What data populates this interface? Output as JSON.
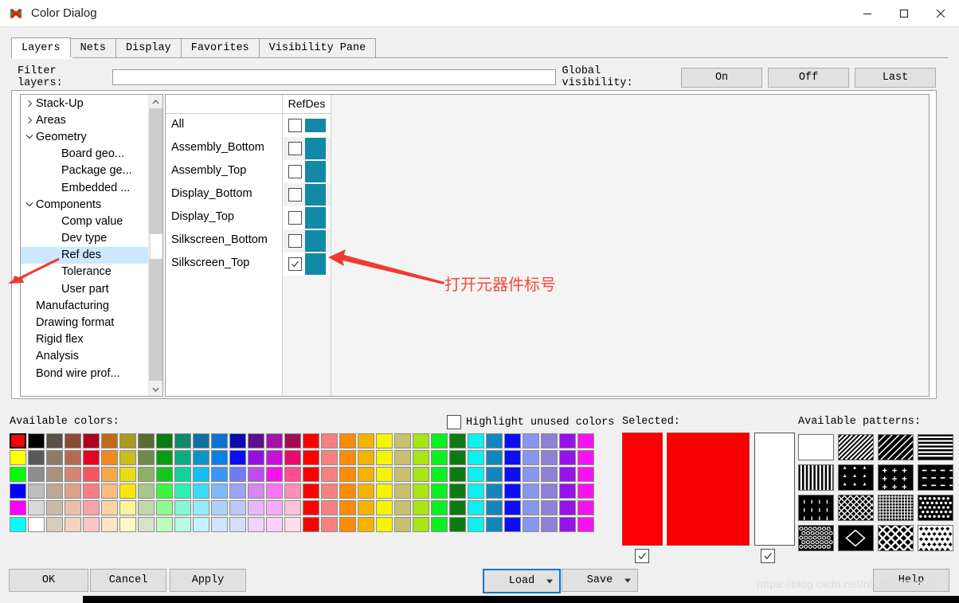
{
  "window": {
    "title": "Color Dialog",
    "app_icon": "butterfly-icon",
    "minimize": "—",
    "maximize": "□",
    "close": "✕"
  },
  "tabs": [
    {
      "label": "Layers",
      "active": true
    },
    {
      "label": "Nets",
      "active": false
    },
    {
      "label": "Display",
      "active": false
    },
    {
      "label": "Favorites",
      "active": false
    },
    {
      "label": "Visibility Pane",
      "active": false
    }
  ],
  "filter": {
    "label": "Filter layers:",
    "value": "",
    "placeholder": ""
  },
  "global_visibility": {
    "label": "Global visibility:",
    "buttons": [
      "On",
      "Off",
      "Last"
    ]
  },
  "tree": {
    "nodes": [
      {
        "label": "Stack-Up",
        "indent": 0,
        "chevron": "right",
        "selected": false
      },
      {
        "label": "Areas",
        "indent": 0,
        "chevron": "right",
        "selected": false
      },
      {
        "label": "Geometry",
        "indent": 0,
        "chevron": "down",
        "selected": false
      },
      {
        "label": "Board geo...",
        "indent": 1,
        "chevron": "none",
        "selected": false
      },
      {
        "label": "Package ge...",
        "indent": 1,
        "chevron": "none",
        "selected": false
      },
      {
        "label": "Embedded ...",
        "indent": 1,
        "chevron": "none",
        "selected": false
      },
      {
        "label": "Components",
        "indent": 0,
        "chevron": "down",
        "selected": false
      },
      {
        "label": "Comp value",
        "indent": 1,
        "chevron": "none",
        "selected": false
      },
      {
        "label": "Dev type",
        "indent": 1,
        "chevron": "none",
        "selected": false
      },
      {
        "label": "Ref des",
        "indent": 1,
        "chevron": "none",
        "selected": true
      },
      {
        "label": "Tolerance",
        "indent": 1,
        "chevron": "none",
        "selected": false
      },
      {
        "label": "User part",
        "indent": 1,
        "chevron": "none",
        "selected": false
      },
      {
        "label": "Manufacturing",
        "indent": 0,
        "chevron": "none",
        "selected": false
      },
      {
        "label": "Drawing format",
        "indent": 0,
        "chevron": "none",
        "selected": false
      },
      {
        "label": "Rigid flex",
        "indent": 0,
        "chevron": "none",
        "selected": false
      },
      {
        "label": "Analysis",
        "indent": 0,
        "chevron": "none",
        "selected": false
      },
      {
        "label": "Bond wire prof...",
        "indent": 0,
        "chevron": "none",
        "selected": false
      }
    ],
    "scroll_up": "⌃",
    "scroll_down": "⌄"
  },
  "layer_table": {
    "column_header": "RefDes",
    "swatch_color": "#1289a7",
    "rows": [
      {
        "name": "All",
        "checked": false,
        "color": "#1289a7",
        "is_all": true
      },
      {
        "name": "Assembly_Bottom",
        "checked": false,
        "color": "#1289a7",
        "is_all": false
      },
      {
        "name": "Assembly_Top",
        "checked": false,
        "color": "#1289a7",
        "is_all": false
      },
      {
        "name": "Display_Bottom",
        "checked": false,
        "color": "#1289a7",
        "is_all": false
      },
      {
        "name": "Display_Top",
        "checked": false,
        "color": "#1289a7",
        "is_all": false
      },
      {
        "name": "Silkscreen_Bottom",
        "checked": false,
        "color": "#1289a7",
        "is_all": false
      },
      {
        "name": "Silkscreen_Top",
        "checked": true,
        "color": "#1289a7",
        "is_all": false
      }
    ]
  },
  "available_colors": {
    "label": "Available colors:",
    "columns": 32,
    "rows": 6,
    "selected_index": 0,
    "grid": [
      [
        "#ff0000",
        "#000000",
        "#5c4f46",
        "#8a4b34",
        "#b00020",
        "#c06a18",
        "#a99a22",
        "#5a6b34",
        "#0d7a14",
        "#0d8a6a",
        "#1070a0",
        "#0f72d1",
        "#0b0bb0",
        "#5c118f",
        "#a113a9",
        "#a30c50",
        "#fc0000",
        "#f78080",
        "#fb8c00",
        "#f5b300",
        "#f7f400",
        "#c7c06e",
        "#a8e514",
        "#0bf020",
        "#0d7a14",
        "#0df0f0",
        "#1287bb",
        "#0d0df5",
        "#8796f0",
        "#8f7fd6",
        "#9612e8",
        "#f613ef"
      ],
      [
        "#ffff00",
        "#595959",
        "#8d7a68",
        "#b56a52",
        "#e60022",
        "#f08a1e",
        "#c9bc1d",
        "#6e8a4a",
        "#0b9b11",
        "#0cac80",
        "#0e94c4",
        "#0d7fe0",
        "#0d0df5",
        "#9211e0",
        "#c513d9",
        "#e70c6b",
        "#fc0000",
        "#f78080",
        "#fb8c00",
        "#f5b300",
        "#f7f400",
        "#c7c06e",
        "#a8e514",
        "#0bf020",
        "#0d7a14",
        "#0df0f0",
        "#1287bb",
        "#0d0df5",
        "#8796f0",
        "#8f7fd6",
        "#9612e8",
        "#f613ef"
      ],
      [
        "#00ff00",
        "#8d8d8d",
        "#a7937e",
        "#d28671",
        "#f65662",
        "#f7a84c",
        "#e8dc16",
        "#8fb06a",
        "#13c71a",
        "#12d49a",
        "#13bff0",
        "#3b96f7",
        "#6f7cf5",
        "#c04cf0",
        "#f613ef",
        "#ff4d94",
        "#fc0000",
        "#f78080",
        "#fb8c00",
        "#f5b300",
        "#f7f400",
        "#c7c06e",
        "#a8e514",
        "#0bf020",
        "#0d7a14",
        "#0df0f0",
        "#1287bb",
        "#0d0df5",
        "#8796f0",
        "#8f7fd6",
        "#9612e8",
        "#f613ef"
      ],
      [
        "#0000ff",
        "#bdbdbd",
        "#bda894",
        "#e0a189",
        "#f97c86",
        "#fabd7c",
        "#fbe60b",
        "#abc68e",
        "#3ef53e",
        "#2ef0b5",
        "#3ddbfb",
        "#7cb9fa",
        "#9aa4f9",
        "#d985f5",
        "#f976f5",
        "#ff8fb5",
        "#fc0000",
        "#f78080",
        "#fb8c00",
        "#f5b300",
        "#f7f400",
        "#c7c06e",
        "#a8e514",
        "#0bf020",
        "#0d7a14",
        "#0df0f0",
        "#1287bb",
        "#0d0df5",
        "#8796f0",
        "#8f7fd6",
        "#9612e8",
        "#f613ef"
      ],
      [
        "#ff00ff",
        "#d9d9d9",
        "#cbb9a8",
        "#edbfa9",
        "#fba2a8",
        "#fcd3a5",
        "#fdf49a",
        "#c6d6ae",
        "#8ff98f",
        "#86f7d4",
        "#95ebfc",
        "#aed2fc",
        "#c0c6fb",
        "#e8b6f8",
        "#fbaaf8",
        "#ffc2d6",
        "#fc0000",
        "#f78080",
        "#fb8c00",
        "#f5b300",
        "#f7f400",
        "#c7c06e",
        "#a8e514",
        "#0bf020",
        "#0d7a14",
        "#0df0f0",
        "#1287bb",
        "#0d0df5",
        "#8796f0",
        "#8f7fd6",
        "#9612e8",
        "#f613ef"
      ],
      [
        "#00ffff",
        "#ffffff",
        "#d9cbbd",
        "#f2d4c4",
        "#fcc6c9",
        "#fde4c7",
        "#fef8c6",
        "#d8e2c8",
        "#bdfbbd",
        "#b9fae5",
        "#c2f3fd",
        "#cfe4fd",
        "#d8dcfc",
        "#f1d2fa",
        "#fdd0fb",
        "#ffdde9",
        "#fc0000",
        "#f78080",
        "#fb8c00",
        "#f5b300",
        "#f7f400",
        "#c7c06e",
        "#a8e514",
        "#0bf020",
        "#0d7a14",
        "#0df0f0",
        "#1287bb",
        "#0d0df5",
        "#8796f0",
        "#8f7fd6",
        "#9612e8",
        "#f613ef"
      ]
    ]
  },
  "highlight_unused": {
    "label": "Highlight unused colors",
    "checked": false
  },
  "selected": {
    "label": "Selected:",
    "swatch_a_color": "#fa0000",
    "swatch_b_color": "#f90000",
    "swatch_c_color": "#ffffff",
    "checkbox_a_checked": true,
    "checkbox_c_checked": true
  },
  "available_patterns": {
    "label": "Available patterns:",
    "names": [
      "solid-none",
      "diagonal-stripes-left",
      "diagonal-stripes-thin",
      "horizontal-stripes",
      "vertical-stripes",
      "triangles",
      "plus-signs",
      "short-dashes",
      "vertical-ticks",
      "crosshatch-diagonal",
      "fine-grid",
      "dots-diamond",
      "small-circles",
      "large-diamond",
      "diagonal-cross",
      "diamond-dots"
    ]
  },
  "footer": {
    "ok": "OK",
    "cancel": "Cancel",
    "apply": "Apply",
    "load": "Load",
    "save": "Save",
    "help": "Help"
  },
  "annotation": {
    "text": "打开元器件标号",
    "color": "#f4483f"
  },
  "watermark": {
    "text": "https://blog.csdn.net/n0_57372216"
  }
}
